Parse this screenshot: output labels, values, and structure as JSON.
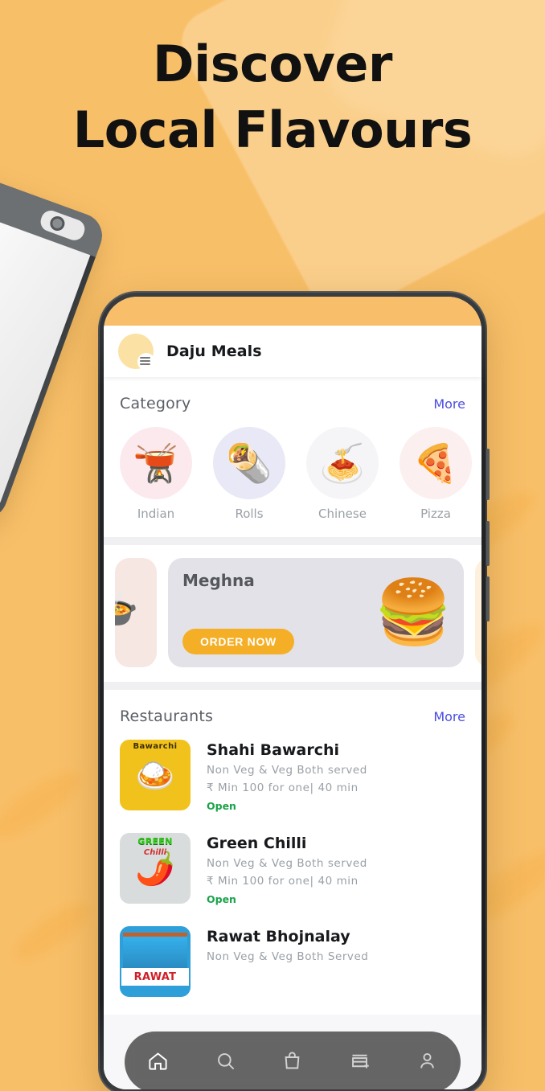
{
  "promo": {
    "headline_line1": "Discover",
    "headline_line2": "Local Flavours"
  },
  "app": {
    "title": "Daju Meals",
    "logo_icon": "hamburger-menu-icon"
  },
  "category_section": {
    "title": "Category",
    "more_label": "More",
    "items": [
      {
        "label": "Indian",
        "glyph": "🫕",
        "bubble_color": "#FBE9EE"
      },
      {
        "label": "Rolls",
        "glyph": "🌯",
        "bubble_color": "#E8E8F6"
      },
      {
        "label": "Chinese",
        "glyph": "🍝",
        "bubble_color": "#F5F5F8"
      },
      {
        "label": "Pizza",
        "glyph": "🍕",
        "bubble_color": "#FBEFEF"
      },
      {
        "label": "",
        "glyph": "",
        "bubble_color": "#FBE9EE"
      }
    ]
  },
  "banner_section": {
    "title": "Meghna",
    "cta_label": "ORDER NOW",
    "glyph": "🍔"
  },
  "restaurant_section": {
    "title": "Restaurants",
    "more_label": "More",
    "items": [
      {
        "name": "Shahi Bawarchi",
        "served": "Non Veg & Veg Both served",
        "price_time": "₹ Min 100 for one| 40 min",
        "status": "Open",
        "thumb_label": "Bawarchi",
        "thumb_glyph": "🍛"
      },
      {
        "name": "Green Chilli",
        "served": "Non Veg & Veg Both served",
        "price_time": "₹ Min 100 for one| 40 min",
        "status": "Open",
        "thumb_label": "GREEN",
        "thumb_label2": "Chilli",
        "thumb_glyph": "🌶️"
      },
      {
        "name": "Rawat Bhojnalay",
        "served": "Non Veg & Veg Both Served",
        "price_time": "",
        "status": "",
        "thumb_label": "RAWAT",
        "thumb_glyph": ""
      }
    ]
  },
  "bottom_nav": {
    "items": [
      {
        "icon": "home-icon",
        "active": true
      },
      {
        "icon": "search-icon",
        "active": false
      },
      {
        "icon": "shopping-bag-icon",
        "active": false
      },
      {
        "icon": "add-store-icon",
        "active": false
      },
      {
        "icon": "person-icon",
        "active": false
      }
    ]
  },
  "colors": {
    "background": "#F8BF69",
    "accent_orange": "#F5AF27",
    "link_blue": "#4A4EE0",
    "status_green": "#1AA34A"
  }
}
